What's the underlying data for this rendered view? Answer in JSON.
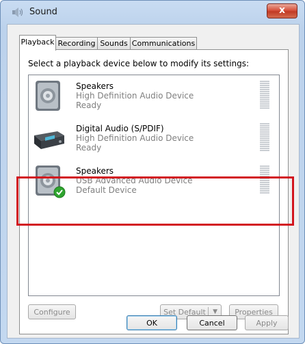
{
  "window": {
    "title": "Sound",
    "close_label": "x"
  },
  "tabs": [
    {
      "label": "Playback",
      "active": true
    },
    {
      "label": "Recording",
      "active": false
    },
    {
      "label": "Sounds",
      "active": false
    },
    {
      "label": "Communications",
      "active": false
    }
  ],
  "instruction": "Select a playback device below to modify its settings:",
  "devices": [
    {
      "name": "Speakers",
      "description": "High Definition Audio Device",
      "status": "Ready",
      "icon": "speaker-icon",
      "default": false
    },
    {
      "name": "Digital Audio (S/PDIF)",
      "description": "High Definition Audio Device",
      "status": "Ready",
      "icon": "digital-audio-receiver-icon",
      "default": false
    },
    {
      "name": "Speakers",
      "description": "USB Advanced Audio Device",
      "status": "Default Device",
      "icon": "speaker-icon",
      "default": true
    }
  ],
  "buttons": {
    "configure": "Configure",
    "set_default": "Set Default",
    "properties": "Properties",
    "ok": "OK",
    "cancel": "Cancel",
    "apply": "Apply"
  },
  "colors": {
    "highlight": "#d2141e",
    "default_check": "#2fa52f"
  }
}
